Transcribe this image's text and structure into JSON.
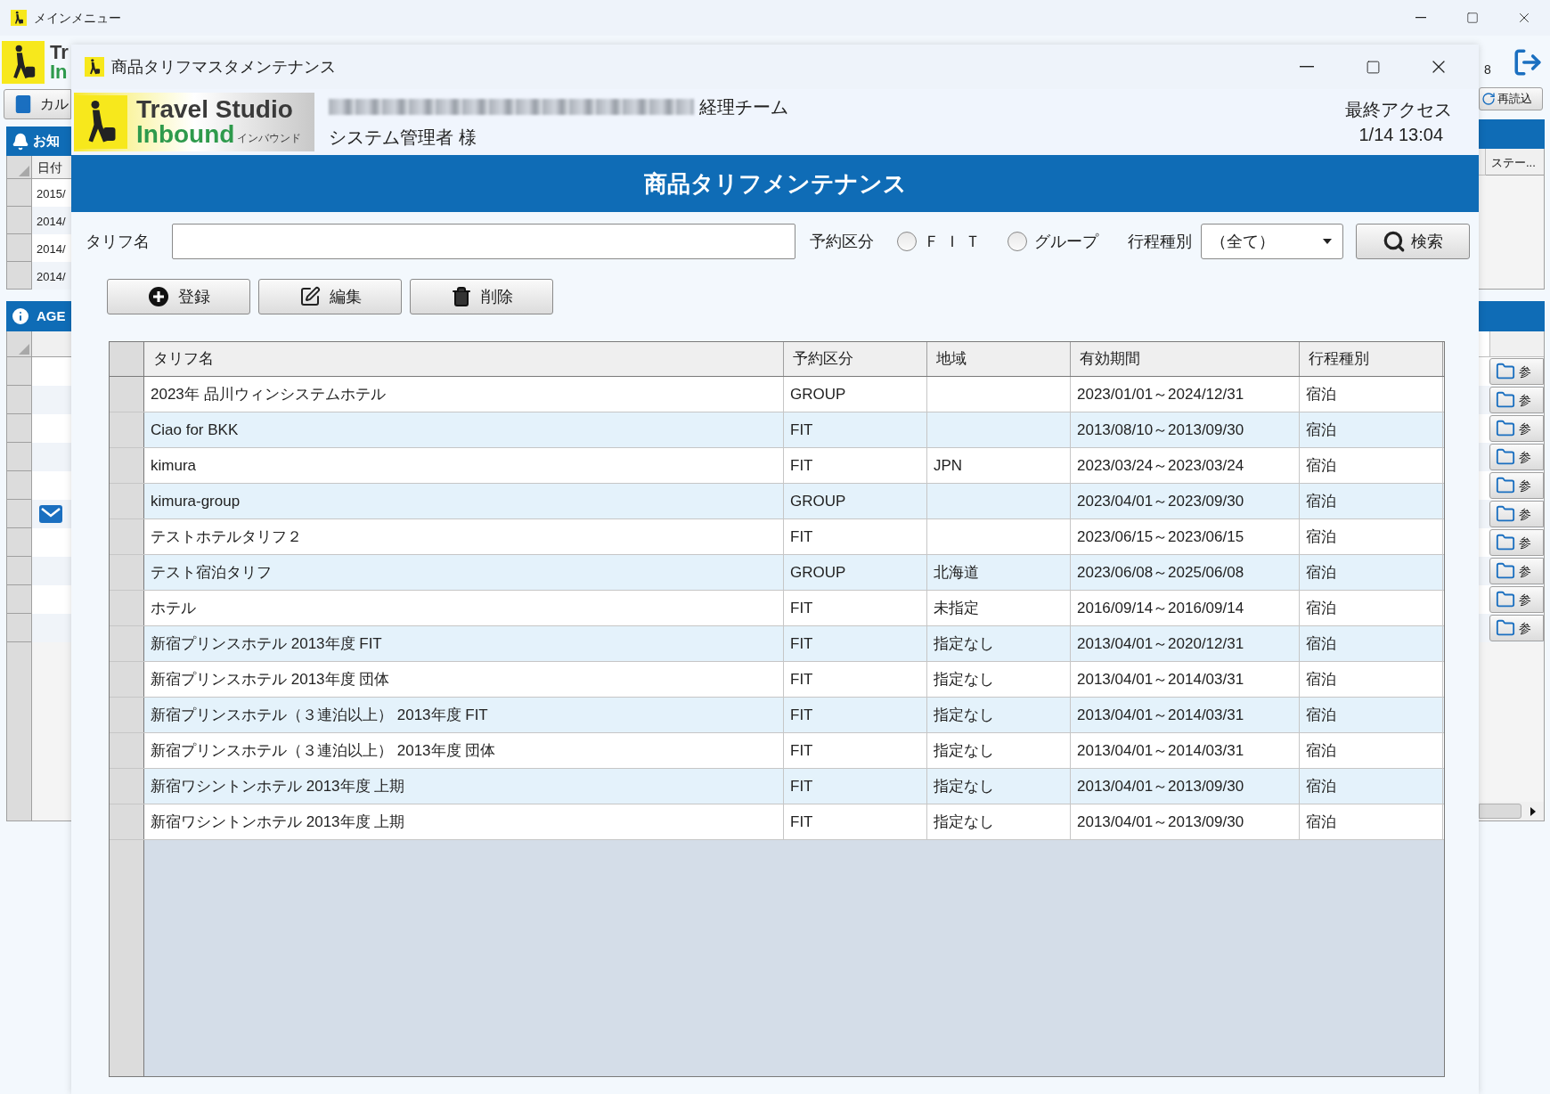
{
  "main_window": {
    "title": "メインメニュー",
    "logo_lines": [
      "Tr",
      "In"
    ],
    "nav_button": "カル",
    "user_fragment": "8",
    "reload_button": "再読込",
    "notice_panel": {
      "title": "お知",
      "column": "日付",
      "rows": [
        "2015/",
        "2014/",
        "2014/",
        "2014/"
      ],
      "right_column": "ステー..."
    },
    "agent_panel": {
      "title": "AGE",
      "rows": [
        {
          "mail": false,
          "button": "参"
        },
        {
          "mail": false,
          "button": "参"
        },
        {
          "mail": false,
          "button": "参"
        },
        {
          "mail": false,
          "button": "参"
        },
        {
          "mail": false,
          "button": "参"
        },
        {
          "mail": true,
          "button": "参"
        },
        {
          "mail": false,
          "button": "参"
        },
        {
          "mail": false,
          "button": "参"
        },
        {
          "mail": false,
          "button": "参"
        },
        {
          "mail": false,
          "button": "参"
        }
      ]
    }
  },
  "dialog": {
    "title": "商品タリフマスタメンテナンス",
    "logo": {
      "line1": "Travel Studio",
      "line2": "Inbound",
      "sub": "インバウンド"
    },
    "team": "経理チーム",
    "user": "システム管理者 様",
    "last_access_label": "最終アクセス",
    "last_access": "1/14 13:04",
    "banner": "商品タリフメンテナンス",
    "search": {
      "tariff_label": "タリフ名",
      "booking_label": "予約区分",
      "radios": [
        {
          "label": "ＦＩＴ",
          "selected": false
        },
        {
          "label": "グループ",
          "selected": false
        }
      ],
      "itinerary_label": "行程種別",
      "itinerary_value": "（全て）",
      "search_button": "検索"
    },
    "actions": [
      {
        "kind": "add",
        "label": "登録"
      },
      {
        "kind": "edit",
        "label": "編集"
      },
      {
        "kind": "delete",
        "label": "削除"
      }
    ],
    "table": {
      "columns": [
        "タリフ名",
        "予約区分",
        "地域",
        "有効期間",
        "行程種別"
      ],
      "rows": [
        [
          "2023年 品川ウィンシステムホテル",
          "GROUP",
          "",
          "2023/01/01～2024/12/31",
          "宿泊"
        ],
        [
          "Ciao for BKK",
          "FIT",
          "",
          "2013/08/10～2013/09/30",
          "宿泊"
        ],
        [
          "kimura",
          "FIT",
          "JPN",
          "2023/03/24～2023/03/24",
          "宿泊"
        ],
        [
          "kimura-group",
          "GROUP",
          "",
          "2023/04/01～2023/09/30",
          "宿泊"
        ],
        [
          "テストホテルタリフ２",
          "FIT",
          "",
          "2023/06/15～2023/06/15",
          "宿泊"
        ],
        [
          "テスト宿泊タリフ",
          "GROUP",
          "北海道",
          "2023/06/08～2025/06/08",
          "宿泊"
        ],
        [
          "ホテル",
          "FIT",
          "未指定",
          "2016/09/14～2016/09/14",
          "宿泊"
        ],
        [
          "新宿プリンスホテル 2013年度 FIT",
          "FIT",
          "指定なし",
          "2013/04/01～2020/12/31",
          "宿泊"
        ],
        [
          "新宿プリンスホテル 2013年度 団体",
          "FIT",
          "指定なし",
          "2013/04/01～2014/03/31",
          "宿泊"
        ],
        [
          "新宿プリンスホテル（３連泊以上） 2013年度 FIT",
          "FIT",
          "指定なし",
          "2013/04/01～2014/03/31",
          "宿泊"
        ],
        [
          "新宿プリンスホテル（３連泊以上） 2013年度 団体",
          "FIT",
          "指定なし",
          "2013/04/01～2014/03/31",
          "宿泊"
        ],
        [
          "新宿ワシントンホテル 2013年度 上期",
          "FIT",
          "指定なし",
          "2013/04/01～2013/09/30",
          "宿泊"
        ],
        [
          "新宿ワシントンホテル 2013年度 上期",
          "FIT",
          "指定なし",
          "2013/04/01～2013/09/30",
          "宿泊"
        ]
      ]
    }
  }
}
